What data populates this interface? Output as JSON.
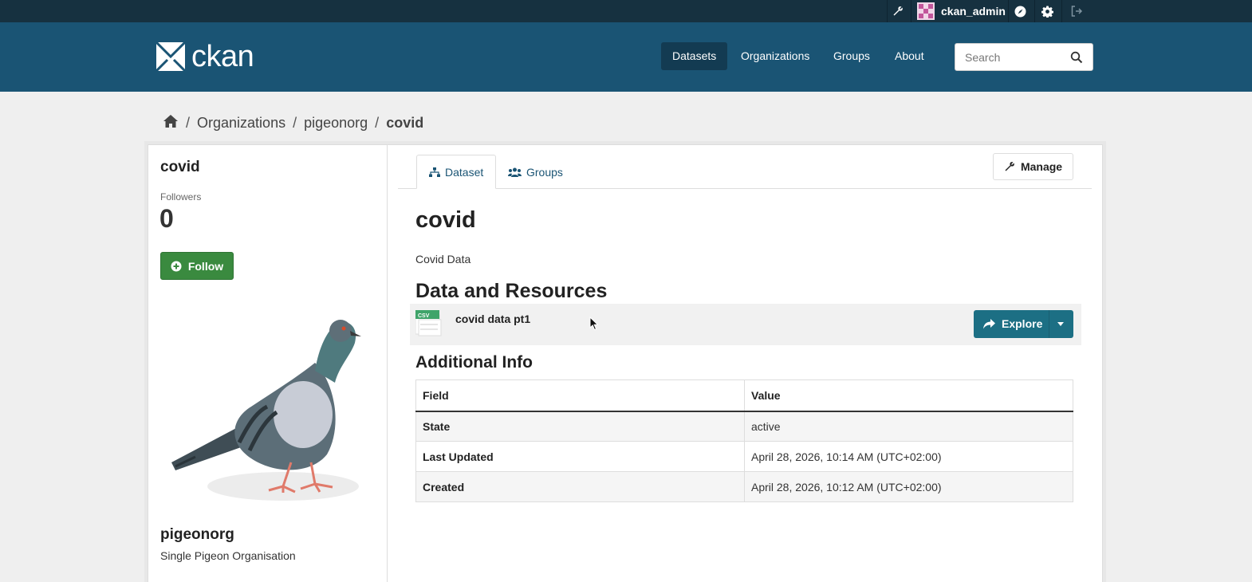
{
  "account": {
    "username": "ckan_admin"
  },
  "header": {
    "logo_text": "ckan",
    "nav": [
      {
        "label": "Datasets",
        "active": true
      },
      {
        "label": "Organizations",
        "active": false
      },
      {
        "label": "Groups",
        "active": false
      },
      {
        "label": "About",
        "active": false
      }
    ],
    "search_placeholder": "Search"
  },
  "breadcrumb": {
    "items": [
      "Organizations",
      "pigeonorg"
    ],
    "current": "covid"
  },
  "sidebar": {
    "title": "covid",
    "followers_label": "Followers",
    "followers_count": "0",
    "follow_label": "Follow",
    "org_name": "pigeonorg",
    "org_description": "Single Pigeon Organisation"
  },
  "tabs": [
    {
      "label": "Dataset",
      "icon": "sitemap-icon",
      "active": true
    },
    {
      "label": "Groups",
      "icon": "users-icon",
      "active": false
    }
  ],
  "manage_label": "Manage",
  "dataset": {
    "title": "covid",
    "notes": "Covid Data",
    "resources_heading": "Data and Resources",
    "resource": {
      "format": "CSV",
      "name": "covid data pt1",
      "explore_label": "Explore"
    },
    "additional_heading": "Additional Info",
    "table": {
      "headers": [
        "Field",
        "Value"
      ],
      "rows": [
        [
          "State",
          "active"
        ],
        [
          "Last Updated",
          "April 28, 2026, 10:14 AM (UTC+02:00)"
        ],
        [
          "Created",
          "April 28, 2026, 10:12 AM (UTC+02:00)"
        ]
      ]
    }
  },
  "colors": {
    "masthead": "#1a5474",
    "account_bar": "#163140",
    "follow_button": "#3a8a3f",
    "explore_button": "#1c6f84"
  }
}
